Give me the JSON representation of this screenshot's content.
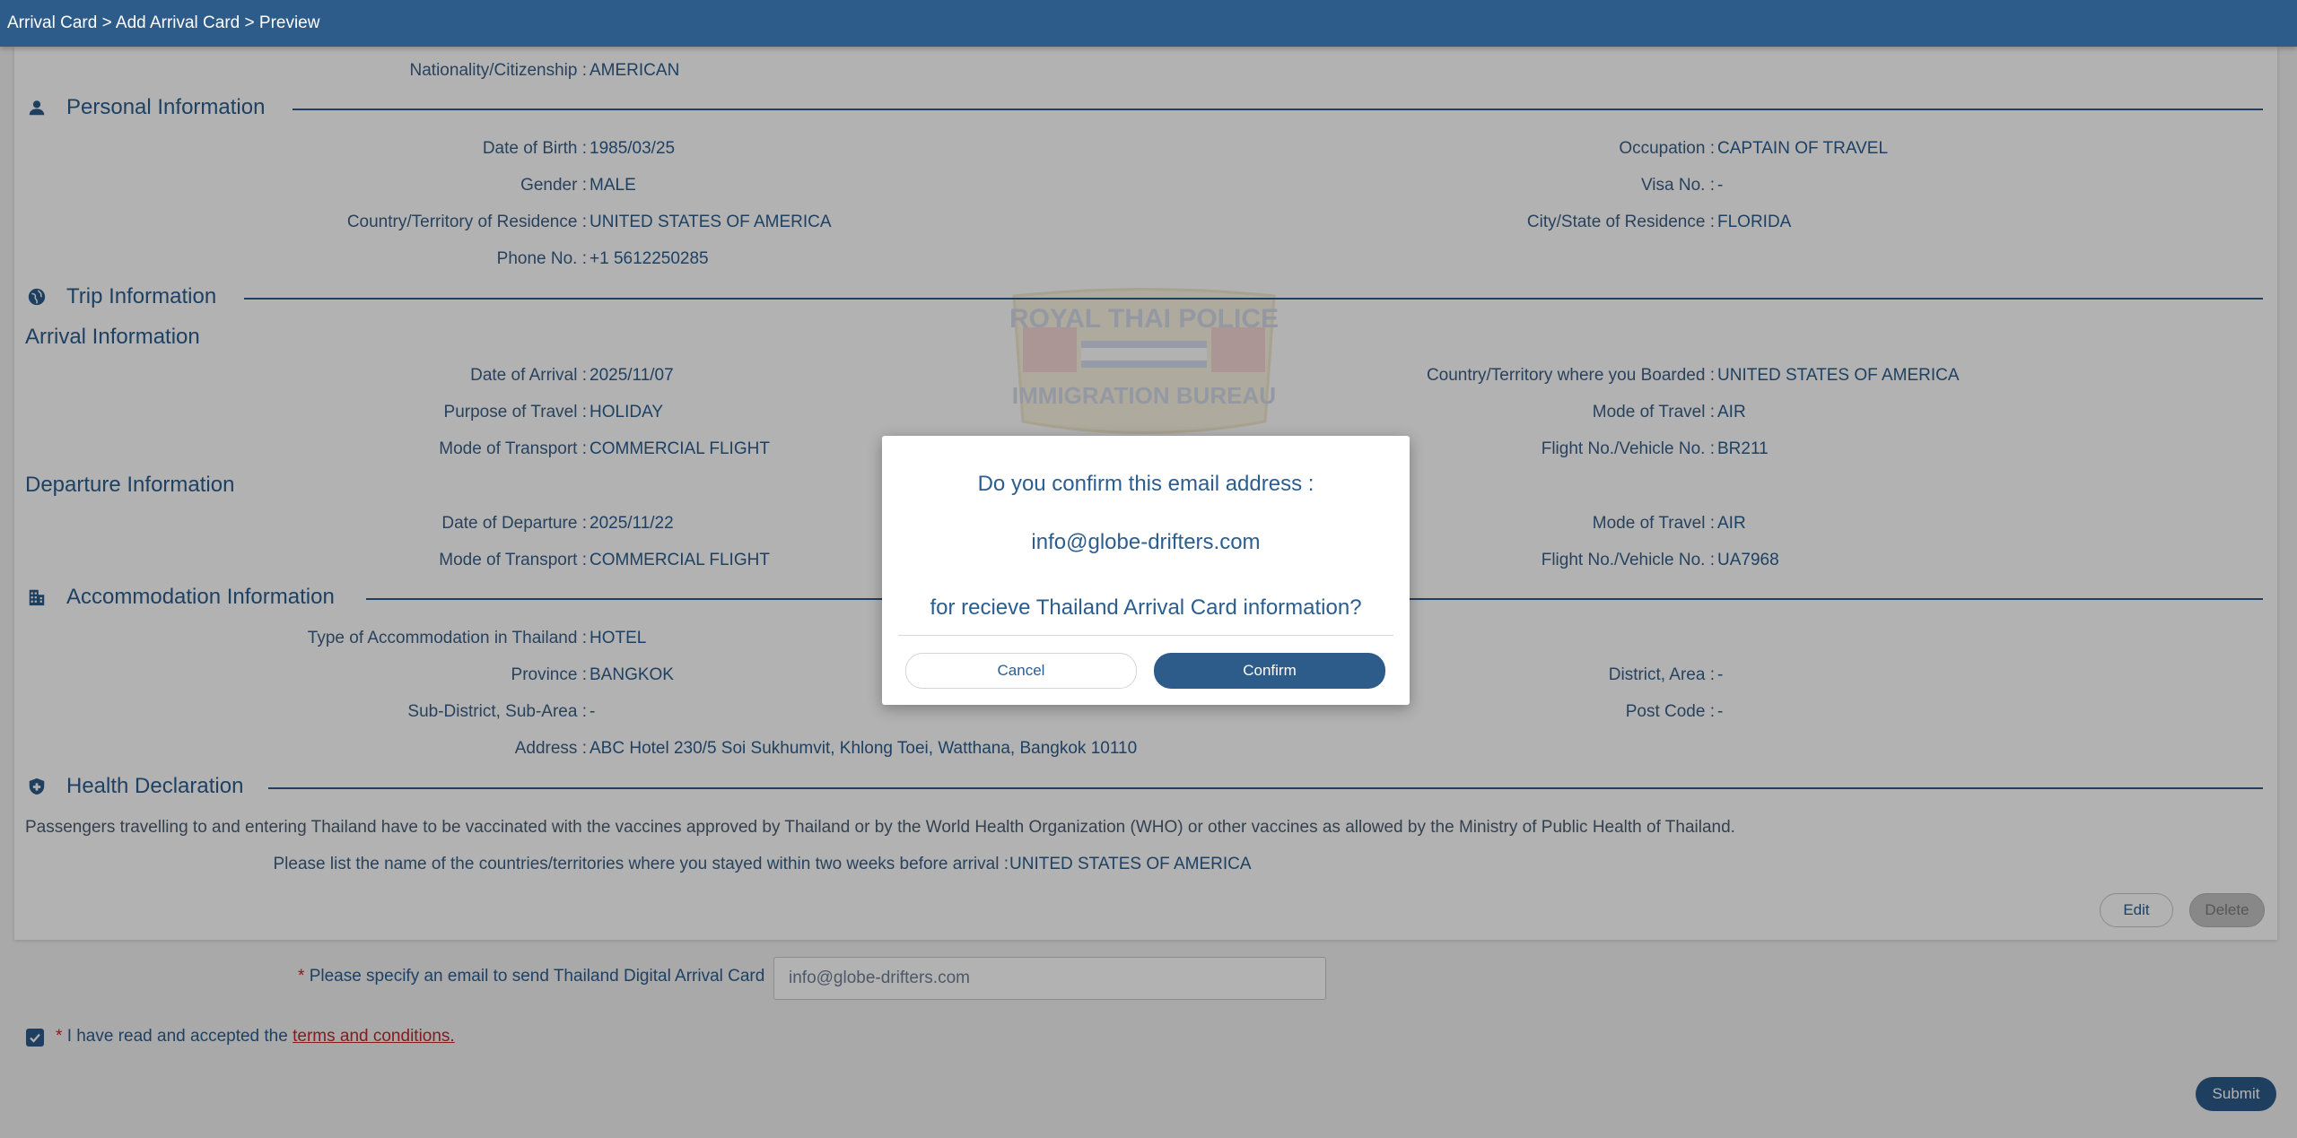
{
  "breadcrumb": "Arrival Card > Add Arrival Card > Preview",
  "nationality": {
    "label": "Nationality/Citizenship :",
    "value": "AMERICAN"
  },
  "personal": {
    "title": "Personal Information",
    "dob": {
      "label": "Date of Birth :",
      "value": "1985/03/25"
    },
    "gender": {
      "label": "Gender :",
      "value": "MALE"
    },
    "country": {
      "label": "Country/Territory of Residence :",
      "value": "UNITED STATES OF AMERICA"
    },
    "phone": {
      "label": "Phone No. :",
      "value": "+1 5612250285"
    },
    "occupation": {
      "label": "Occupation :",
      "value": "CAPTAIN OF TRAVEL"
    },
    "visa": {
      "label": "Visa No. :",
      "value": "-"
    },
    "city": {
      "label": "City/State of Residence :",
      "value": "FLORIDA"
    }
  },
  "trip": {
    "title": "Trip Information",
    "arrival_title": "Arrival Information",
    "arrival": {
      "date": {
        "label": "Date of Arrival :",
        "value": "2025/11/07"
      },
      "purpose": {
        "label": "Purpose of Travel :",
        "value": "HOLIDAY"
      },
      "transport": {
        "label": "Mode of Transport :",
        "value": "COMMERCIAL FLIGHT"
      },
      "boarded": {
        "label": "Country/Territory where you Boarded :",
        "value": "UNITED STATES OF AMERICA"
      },
      "mode": {
        "label": "Mode of Travel :",
        "value": "AIR"
      },
      "flight": {
        "label": "Flight No./Vehicle No. :",
        "value": "BR211"
      }
    },
    "departure_title": "Departure Information",
    "departure": {
      "date": {
        "label": "Date of Departure :",
        "value": "2025/11/22"
      },
      "transport": {
        "label": "Mode of Transport :",
        "value": "COMMERCIAL FLIGHT"
      },
      "mode": {
        "label": "Mode of Travel :",
        "value": "AIR"
      },
      "flight": {
        "label": "Flight No./Vehicle No. :",
        "value": "UA7968"
      }
    }
  },
  "accommodation": {
    "title": "Accommodation Information",
    "type": {
      "label": "Type of Accommodation in Thailand :",
      "value": "HOTEL"
    },
    "province": {
      "label": "Province :",
      "value": "BANGKOK"
    },
    "subdistrict": {
      "label": "Sub-District, Sub-Area :",
      "value": "-"
    },
    "address": {
      "label": "Address :",
      "value": "ABC Hotel 230/5 Soi Sukhumvit, Khlong Toei, Watthana, Bangkok 10110"
    },
    "district": {
      "label": "District, Area :",
      "value": "-"
    },
    "postcode": {
      "label": "Post Code :",
      "value": "-"
    }
  },
  "health": {
    "title": "Health Declaration",
    "notice": "Passengers travelling to and entering Thailand have to be vaccinated with the vaccines approved by Thailand or by the World Health Organization (WHO) or other vaccines as allowed by the Ministry of Public Health of Thailand.",
    "countries": {
      "label": "Please list the name of the countries/territories where you stayed within two weeks before arrival :",
      "value": "UNITED STATES OF AMERICA"
    }
  },
  "actions": {
    "edit": "Edit",
    "delete": "Delete",
    "submit": "Submit"
  },
  "email_field": {
    "label": "Please specify an email to send Thailand Digital Arrival Card",
    "value": "info@globe-drifters.com",
    "required_mark": "*"
  },
  "terms": {
    "prefix": "I have read and accepted the",
    "link": "terms and conditions.",
    "required_mark": "*",
    "checked": true
  },
  "watermark": {
    "top_text": "ROYAL THAI POLICE",
    "bottom_text": "IMMIGRATION BUREAU"
  },
  "modal": {
    "line1": "Do you confirm this email address :",
    "email": "info@globe-drifters.com",
    "line3": "for recieve Thailand Arrival Card information?",
    "cancel": "Cancel",
    "confirm": "Confirm"
  },
  "colors": {
    "primary": "#2d5b8a",
    "text": "#2b5d8e",
    "link": "#c0282d"
  }
}
